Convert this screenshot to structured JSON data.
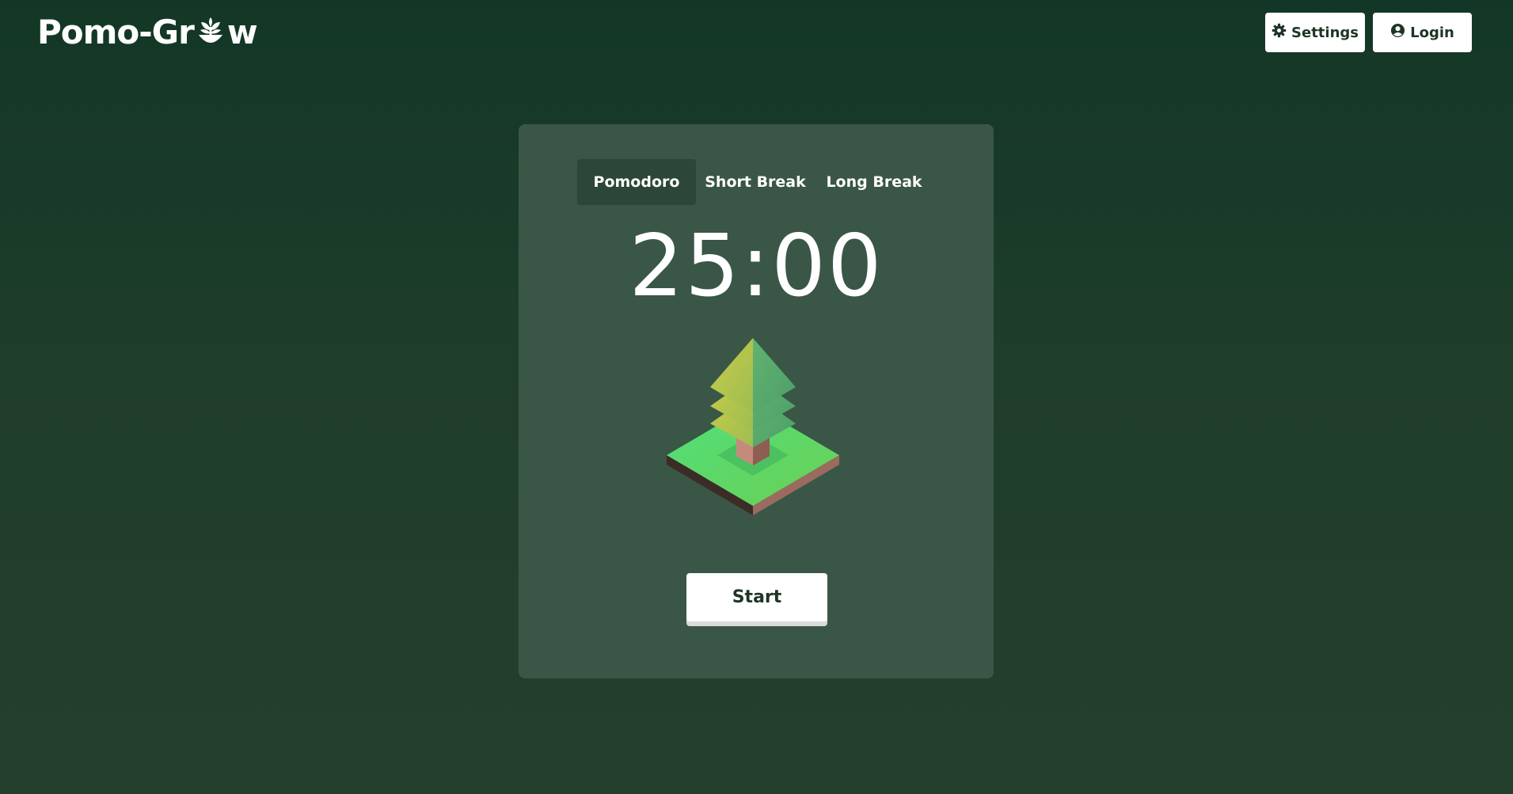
{
  "app": {
    "logo_text_before": "Pomo-Gr",
    "logo_text_after": "w",
    "logo_icon": "sprout-icon"
  },
  "header": {
    "settings_label": "Settings",
    "settings_icon": "gear-icon",
    "login_label": "Login",
    "login_icon": "user-circle-icon"
  },
  "timer": {
    "tabs": [
      {
        "label": "Pomodoro",
        "active": true
      },
      {
        "label": "Short Break",
        "active": false
      },
      {
        "label": "Long Break",
        "active": false
      }
    ],
    "display": "25:00",
    "start_label": "Start",
    "illustration": "tree-icon"
  },
  "colors": {
    "background_top": "#133726",
    "background_bottom": "#243f2e",
    "card": "#3a5646",
    "active_tab": "#2c4637",
    "button_bg": "#ffffff",
    "button_text": "#1e3526"
  }
}
